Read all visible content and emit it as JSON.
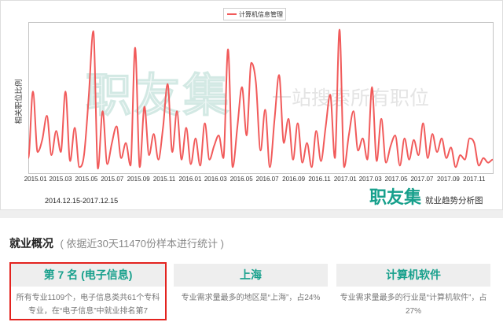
{
  "chart_data": {
    "type": "line",
    "ylabel": "相关职位比例",
    "date_range": "2014.12.15-2017.12.15",
    "x_ticks": [
      "2015.01",
      "2015.03",
      "2015.05",
      "2015.07",
      "2015.09",
      "2015.11",
      "2016.01",
      "2016.03",
      "2016.05",
      "2016.07",
      "2016.09",
      "2016.11",
      "2017.01",
      "2017.03",
      "2017.05",
      "2017.07",
      "2017.09",
      "2017.11"
    ],
    "legend": "top-center",
    "grid": false,
    "series": [
      {
        "name": "计算机信息管理",
        "color": "#f15a5a",
        "values": [
          10,
          54,
          14,
          22,
          38,
          12,
          28,
          14,
          54,
          8,
          30,
          4,
          12,
          50,
          94,
          3,
          41,
          6,
          20,
          31,
          10,
          20,
          5,
          83,
          4,
          44,
          12,
          26,
          9,
          30,
          59,
          14,
          41,
          9,
          30,
          6,
          23,
          5,
          33,
          9,
          18,
          25,
          10,
          82,
          4,
          30,
          57,
          25,
          73,
          60,
          15,
          42,
          4,
          35,
          65,
          20,
          36,
          9,
          33,
          7,
          20,
          4,
          28,
          8,
          30,
          52,
          10,
          95,
          4,
          25,
          41,
          15,
          23,
          9,
          57,
          8,
          36,
          7,
          18,
          25,
          5,
          23,
          9,
          22,
          12,
          33,
          10,
          26,
          14,
          23,
          10,
          17,
          4,
          12,
          9,
          23,
          20,
          5,
          10,
          7,
          9
        ]
      }
    ]
  },
  "watermark": {
    "logo": "职友集",
    "slogan": "一站搜索所有职位"
  },
  "brand": {
    "logo": "职友集",
    "caption": "就业趋势分析图"
  },
  "overview": {
    "title": "就业概况",
    "note": "( 依据近30天11470份样本进行统计 )",
    "cards": [
      {
        "heading": "第 7 名 (电子信息)",
        "text": "所有专业1109个，电子信息类共61个专科专业，在“电子信息”中就业排名第7"
      },
      {
        "heading": "上海",
        "text": "专业需求量最多的地区是“上海”，占24%"
      },
      {
        "heading": "计算机软件",
        "text": "专业需求量最多的行业是“计算机软件”，占27%"
      }
    ]
  },
  "colors": {
    "accent": "#17a08c",
    "highlight": "#e3231f"
  }
}
